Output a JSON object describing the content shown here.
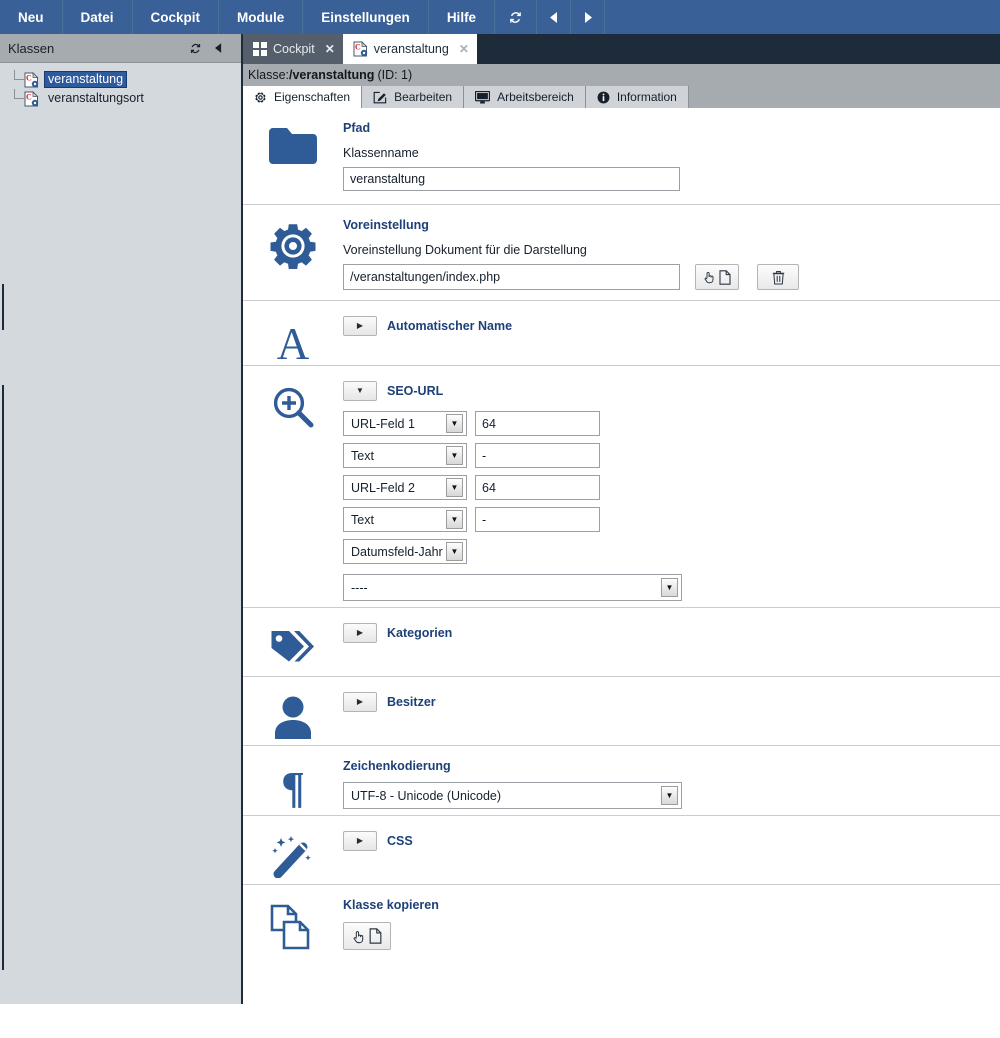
{
  "menubar": {
    "items": [
      {
        "label": "Neu",
        "name": "menu-neu"
      },
      {
        "label": "Datei",
        "name": "menu-datei"
      },
      {
        "label": "Cockpit",
        "name": "menu-cockpit"
      },
      {
        "label": "Module",
        "name": "menu-module"
      },
      {
        "label": "Einstellungen",
        "name": "menu-einstellungen"
      },
      {
        "label": "Hilfe",
        "name": "menu-hilfe"
      }
    ],
    "refresh_icon": "refresh-icon",
    "back_icon": "arrow-left-icon",
    "forward_icon": "arrow-right-icon",
    "accent_color": "#3a6098"
  },
  "sidebar": {
    "title": "Klassen",
    "refresh_icon": "refresh-icon",
    "collapse_icon": "arrow-left-icon",
    "tree": [
      {
        "label": "veranstaltung",
        "selected": true,
        "icon": "class-file-icon"
      },
      {
        "label": "veranstaltungsort",
        "selected": false,
        "icon": "class-file-icon"
      }
    ]
  },
  "doc_tabs": [
    {
      "label": "Cockpit",
      "icon": "grid-icon",
      "close": "✕",
      "active": false
    },
    {
      "label": "veranstaltung",
      "icon": "class-file-icon",
      "close": "✕",
      "active": true
    }
  ],
  "class_header": {
    "prefix": "Klasse:",
    "path": "/veranstaltung",
    "id_text": "(ID: 1)"
  },
  "property_tabs": [
    {
      "label": "Eigenschaften",
      "icon": "gear-icon",
      "active": true
    },
    {
      "label": "Bearbeiten",
      "icon": "pencil-square-icon",
      "active": false
    },
    {
      "label": "Arbeitsbereich",
      "icon": "monitor-icon",
      "active": false
    },
    {
      "label": "Information",
      "icon": "info-circle-icon",
      "active": false
    }
  ],
  "sections": {
    "pfad": {
      "title": "Pfad",
      "icon": "folder-icon",
      "field_label": "Klassenname",
      "field_value": "veranstaltung",
      "field_placeholder": ""
    },
    "voreinstellung": {
      "title": "Voreinstellung",
      "icon": "gear-icon",
      "field_label": "Voreinstellung Dokument für die Darstellung",
      "field_value": "/veranstaltungen/index.php",
      "field_placeholder": "",
      "pick_button_icon": "hand-pointer-file-icon",
      "delete_button_icon": "trash-icon"
    },
    "automatischer_name": {
      "title": "Automatischer Name",
      "icon": "letter-a-icon",
      "expanded": false,
      "toggle_caret": "▶"
    },
    "seo_url": {
      "title": "SEO-URL",
      "icon": "magnifier-plus-icon",
      "expanded": true,
      "toggle_caret": "▼",
      "rows": [
        {
          "select_value": "URL-Feld 1",
          "text_value": "64",
          "has_text": true
        },
        {
          "select_value": "Text",
          "text_value": "-",
          "has_text": true
        },
        {
          "select_value": "URL-Feld 2",
          "text_value": "64",
          "has_text": true
        },
        {
          "select_value": "Text",
          "text_value": "-",
          "has_text": true
        },
        {
          "select_value": "Datumsfeld-Jahr (:",
          "text_value": "",
          "has_text": false
        }
      ],
      "wide_select_value": "----"
    },
    "kategorien": {
      "title": "Kategorien",
      "icon": "tags-icon",
      "expanded": false,
      "toggle_caret": "▶"
    },
    "besitzer": {
      "title": "Besitzer",
      "icon": "user-icon",
      "expanded": false,
      "toggle_caret": "▶"
    },
    "zeichenkodierung": {
      "title": "Zeichenkodierung",
      "icon": "pilcrow-icon",
      "select_value": "UTF-8 - Unicode (Unicode)"
    },
    "css": {
      "title": "CSS",
      "icon": "magic-wand-icon",
      "expanded": false,
      "toggle_caret": "▶"
    },
    "klasse_kopieren": {
      "title": "Klasse kopieren",
      "icon": "copy-pages-icon",
      "pick_button_icon": "hand-pointer-file-icon"
    }
  },
  "colors": {
    "brand_blue": "#3a6098",
    "icon_blue": "#2f5c96",
    "heading_blue": "#1d4077",
    "dark_panel": "#1d2b3a",
    "gray_bar": "#a6abb0",
    "sidebar_bg": "#d4d9de"
  }
}
